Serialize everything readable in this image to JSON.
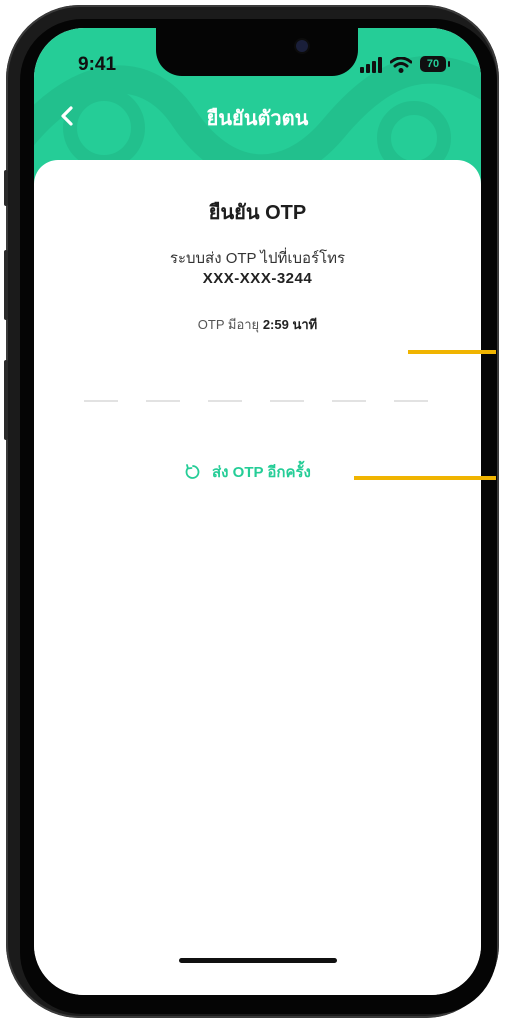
{
  "status_bar": {
    "time": "9:41",
    "battery": "70"
  },
  "header": {
    "title": "ยืนยันตัวตน"
  },
  "content": {
    "heading": "ยืนยัน OTP",
    "description": "ระบบส่ง OTP ไปที่เบอร์โทร",
    "phone_masked": "XXX-XXX-3244",
    "expiry_prefix": "OTP มีอายุ",
    "expiry_time": "2:59 นาที",
    "otp_digits": [
      "",
      "",
      "",
      "",
      "",
      ""
    ],
    "resend_label": "ส่ง OTP อีกครั้ง"
  },
  "colors": {
    "brand": "#25CD97",
    "callout": "#F0B400"
  },
  "icons": {
    "back": "chevron-left-icon",
    "resend": "refresh-icon"
  }
}
